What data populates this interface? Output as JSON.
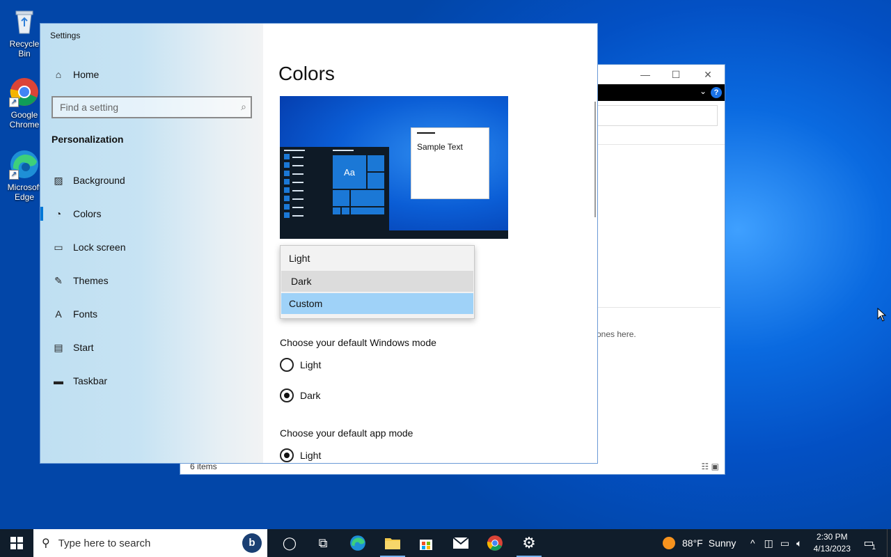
{
  "desktop": {
    "icons": [
      {
        "label": "Recycle Bin",
        "icon": "recycle-bin-icon"
      },
      {
        "label": "Google Chrome",
        "icon": "chrome-icon"
      },
      {
        "label": "Microsoft Edge",
        "icon": "edge-icon"
      }
    ]
  },
  "explorer": {
    "status": "6 items",
    "empty_text": "ones here."
  },
  "settings": {
    "window_title": "Settings",
    "home_label": "Home",
    "search_placeholder": "Find a setting",
    "section_title": "Personalization",
    "nav": [
      {
        "label": "Background",
        "icon": "image-icon"
      },
      {
        "label": "Colors",
        "icon": "palette-icon",
        "active": true
      },
      {
        "label": "Lock screen",
        "icon": "lock-screen-icon"
      },
      {
        "label": "Themes",
        "icon": "brush-icon"
      },
      {
        "label": "Fonts",
        "icon": "font-icon"
      },
      {
        "label": "Start",
        "icon": "start-icon"
      },
      {
        "label": "Taskbar",
        "icon": "taskbar-icon"
      }
    ],
    "page_title": "Colors",
    "preview": {
      "sample_text": "Sample Text",
      "tile_text": "Aa"
    },
    "color_dropdown": {
      "options": [
        "Light",
        "Dark",
        "Custom"
      ],
      "hovered": "Dark",
      "selected": "Custom"
    },
    "windows_mode": {
      "label": "Choose your default Windows mode",
      "options": [
        "Light",
        "Dark"
      ],
      "selected": "Dark"
    },
    "app_mode": {
      "label": "Choose your default app mode",
      "options": [
        "Light"
      ],
      "selected": "Light"
    }
  },
  "taskbar": {
    "search_placeholder": "Type here to search",
    "weather": {
      "temp": "88°F",
      "condition": "Sunny"
    },
    "time": "2:30 PM",
    "date": "4/13/2023",
    "notification_count": "1",
    "accent": "#0078d7"
  }
}
